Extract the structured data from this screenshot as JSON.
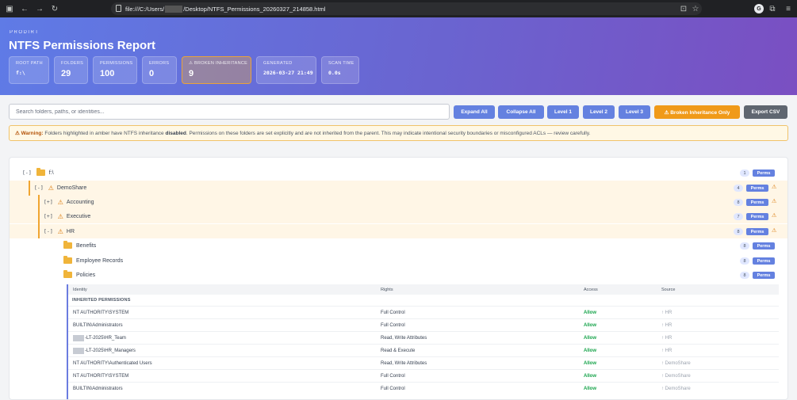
{
  "browser": {
    "url_prefix": "file:///C:/Users/",
    "url_suffix": "/Desktop/NTFS_Permissions_20260327_214858.html",
    "profile_initial": "G"
  },
  "header": {
    "brand": "PRODIRT",
    "title": "NTFS Permissions Report",
    "stats": [
      {
        "label": "ROOT PATH",
        "value": "f:\\"
      },
      {
        "label": "FOLDERS",
        "value": "29"
      },
      {
        "label": "PERMISSIONS",
        "value": "100"
      },
      {
        "label": "ERRORS",
        "value": "0"
      },
      {
        "label": "⚠ BROKEN INHERITANCE",
        "value": "9"
      },
      {
        "label": "GENERATED",
        "value": "2026-03-27 21:49"
      },
      {
        "label": "SCAN TIME",
        "value": "0.0s"
      }
    ]
  },
  "toolbar": {
    "search_placeholder": "Search folders, paths, or identities...",
    "expand_all": "Expand All",
    "collapse_all": "Collapse All",
    "level1": "Level 1",
    "level2": "Level 2",
    "level3": "Level 3",
    "broken_only": "⚠ Broken Inheritance Only",
    "export_csv": "Export CSV"
  },
  "warning": {
    "prefix": "⚠ Warning:",
    "text1": " Folders highlighted in amber have NTFS inheritance ",
    "disabled": "disabled",
    "text2": ". Permissions on these folders are set explicitly and are not inherited from the parent. This may indicate intentional security boundaries or misconfigured ACLs — review carefully."
  },
  "tree": [
    {
      "toggle": "[-]",
      "name": "f:\\",
      "count": "1",
      "perms": "Perms",
      "broken": false
    },
    {
      "toggle": "[-]",
      "name": "DemoShare",
      "count": "4",
      "perms": "Perms",
      "broken": true
    },
    {
      "toggle": "[+]",
      "name": "Accounting",
      "count": "8",
      "perms": "Perms",
      "broken": true
    },
    {
      "toggle": "[+]",
      "name": "Executive",
      "count": "7",
      "perms": "Perms",
      "broken": true
    },
    {
      "toggle": "[-]",
      "name": "HR",
      "count": "8",
      "perms": "Perms",
      "broken": true
    },
    {
      "toggle": "",
      "name": "Benefits",
      "count": "8",
      "perms": "Perms",
      "broken": false
    },
    {
      "toggle": "",
      "name": "Employee Records",
      "count": "8",
      "perms": "Perms",
      "broken": false
    },
    {
      "toggle": "",
      "name": "Policies",
      "count": "8",
      "perms": "Perms",
      "broken": false
    }
  ],
  "permissions": {
    "headers": [
      "Identity",
      "Rights",
      "Access",
      "Source"
    ],
    "section": "INHERITED PERMISSIONS",
    "rows": [
      {
        "identity": "NT AUTHORITY\\SYSTEM",
        "rights": "Full Control",
        "access": "Allow",
        "source": "↑ HR"
      },
      {
        "identity": "BUILTIN\\Administrators",
        "rights": "Full Control",
        "access": "Allow",
        "source": "↑ HR"
      },
      {
        "identity": "-LT-2025\\HR_Team",
        "rights": "Read, Write Attributes",
        "access": "Allow",
        "source": "↑ HR"
      },
      {
        "identity": "-LT-2025\\HR_Managers",
        "rights": "Read & Execute",
        "access": "Allow",
        "source": "↑ HR"
      },
      {
        "identity": "NT AUTHORITY\\Authenticated Users",
        "rights": "Read, Write Attributes",
        "access": "Allow",
        "source": "↑ DemoShare"
      },
      {
        "identity": "NT AUTHORITY\\SYSTEM",
        "rights": "Full Control",
        "access": "Allow",
        "source": "↑ DemoShare"
      },
      {
        "identity": "BUILTIN\\Administrators",
        "rights": "Full Control",
        "access": "Allow",
        "source": "↑ DemoShare"
      }
    ]
  }
}
